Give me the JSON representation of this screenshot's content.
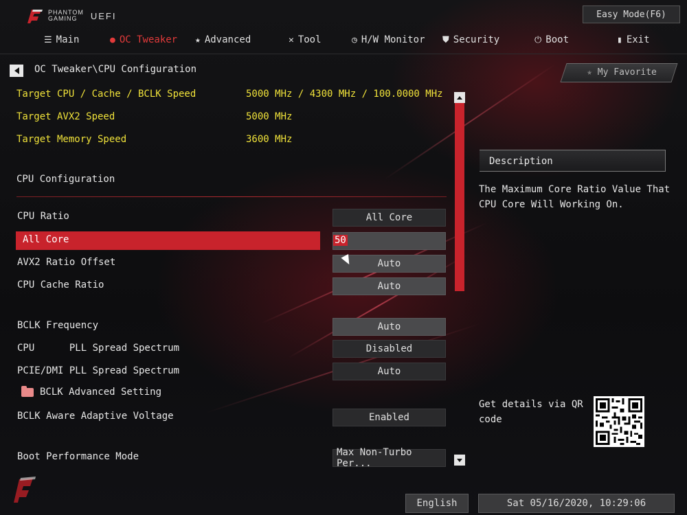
{
  "brand": {
    "line1": "PHANTOM",
    "line2": "GAMING",
    "uefi": "UEFI"
  },
  "easy_mode": "Easy Mode(F6)",
  "nav": [
    {
      "label": "Main",
      "icon": "list-icon"
    },
    {
      "label": "OC Tweaker",
      "icon": "flame-icon",
      "active": true
    },
    {
      "label": "Advanced",
      "icon": "star-icon"
    },
    {
      "label": "Tool",
      "icon": "tools-icon"
    },
    {
      "label": "H/W Monitor",
      "icon": "monitor-gauge-icon"
    },
    {
      "label": "Security",
      "icon": "shield-icon"
    },
    {
      "label": "Boot",
      "icon": "power-icon"
    },
    {
      "label": "Exit",
      "icon": "exit-door-icon"
    }
  ],
  "breadcrumb": "OC Tweaker\\CPU Configuration",
  "favorite": "My Favorite",
  "targets": [
    {
      "label": "Target CPU / Cache / BCLK Speed",
      "value": "5000 MHz / 4300 MHz / 100.0000 MHz"
    },
    {
      "label": "Target AVX2 Speed",
      "value": "5000 MHz"
    },
    {
      "label": "Target Memory Speed",
      "value": "3600 MHz"
    }
  ],
  "section_title": "CPU Configuration",
  "settings": [
    {
      "label": "CPU  Ratio",
      "value": "All Core"
    },
    {
      "label": "All Core",
      "value": "50",
      "selected": true
    },
    {
      "label": "AVX2 Ratio Offset",
      "value": "Auto"
    },
    {
      "label": "CPU  Cache Ratio",
      "value": "Auto"
    },
    {
      "label": "BCLK Frequency",
      "value": "Auto"
    },
    {
      "label": "CPU      PLL Spread Spectrum",
      "value": "Disabled"
    },
    {
      "label": "PCIE/DMI PLL Spread Spectrum",
      "value": "Auto"
    },
    {
      "label": "BCLK Advanced Setting",
      "value": ""
    },
    {
      "label": "BCLK Aware Adaptive Voltage",
      "value": "Enabled"
    },
    {
      "label": "Boot Performance Mode",
      "value": "Max Non-Turbo Per..."
    }
  ],
  "description": {
    "title": "Description",
    "text": "The Maximum Core Ratio Value That CPU Core Will Working On."
  },
  "qr_text": "Get details via QR code",
  "language": "English",
  "datetime": "Sat 05/16/2020, 10:29:06",
  "colors": {
    "accent": "#c8232c",
    "highlight_text": "#f0e23a"
  }
}
